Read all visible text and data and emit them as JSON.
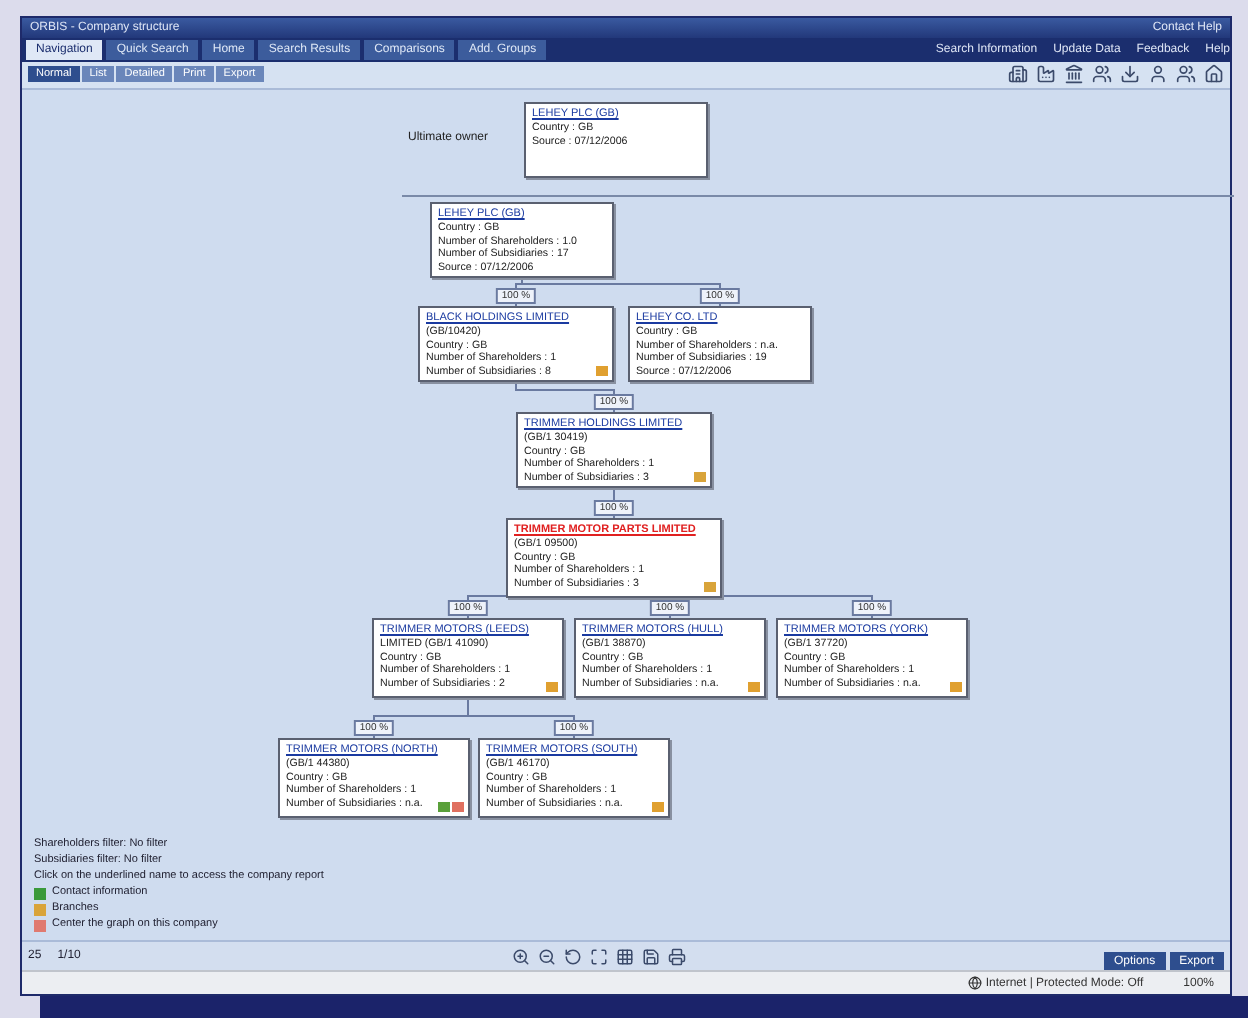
{
  "window": {
    "title": "ORBIS - Company structure",
    "title_right": "Contact Help"
  },
  "tabs": [
    {
      "label": "Navigation",
      "selected": true
    },
    {
      "label": "Quick Search",
      "selected": false
    },
    {
      "label": "Home",
      "selected": false
    },
    {
      "label": "Search Results",
      "selected": false
    },
    {
      "label": "Comparisons",
      "selected": false
    },
    {
      "label": "Add. Groups",
      "selected": false
    }
  ],
  "top_links": [
    "Search Information",
    "Update Data",
    "Feedback",
    "Help"
  ],
  "view_tabs": [
    {
      "label": "Normal",
      "selected": true
    },
    {
      "label": "List",
      "selected": false
    },
    {
      "label": "Detailed",
      "selected": false
    },
    {
      "label": "Print",
      "selected": false
    },
    {
      "label": "Export",
      "selected": false
    }
  ],
  "ultimate_owner_label": "Ultimate owner",
  "graph": {
    "name": "LEHEY PLC (GB)",
    "highlighted": false,
    "lines": [
      "Country : GB",
      "Source : 07/12/2006"
    ],
    "children": [
      {
        "name": "LEHEY PLC (GB)",
        "highlighted": false,
        "lines": [
          "Country : GB",
          "Number of Shareholders : 1.0",
          "Number of Subsidiaries : 17",
          "Source : 07/12/2006"
        ],
        "children": [
          {
            "name": "BLACK HOLDINGS LIMITED",
            "share": "100 %",
            "highlighted": false,
            "lines": [
              "(GB/10420)",
              "Country : GB",
              "Number of Shareholders : 1",
              "Number of Subsidiaries : 8"
            ],
            "flags": [
              {
                "color": "#e0a030"
              }
            ],
            "children": [
              {
                "name": "TRIMMER HOLDINGS LIMITED",
                "share": "100 %",
                "highlighted": false,
                "lines": [
                  "(GB/1 30419)",
                  "Country : GB",
                  "Number of Shareholders : 1",
                  "Number of Subsidiaries : 3"
                ],
                "flags": [
                  {
                    "color": "#d9a43a"
                  }
                ],
                "children": [
                  {
                    "name": "TRIMMER MOTOR PARTS LIMITED",
                    "share": "100 %",
                    "highlighted": true,
                    "lines": [
                      "(GB/1 09500)",
                      "Country : GB",
                      "Number of Shareholders : 1",
                      "Number of Subsidiaries : 3"
                    ],
                    "flags": [
                      {
                        "color": "#d9a43a"
                      }
                    ],
                    "children": [
                      {
                        "name": "TRIMMER MOTORS (LEEDS)",
                        "share": "100 %",
                        "highlighted": false,
                        "lines": [
                          "LIMITED (GB/1 41090)",
                          "Country : GB",
                          "Number of Shareholders : 1",
                          "Number of Subsidiaries : 2"
                        ],
                        "flags": [
                          {
                            "color": "#e0a030"
                          }
                        ],
                        "children": [
                          {
                            "name": "TRIMMER MOTORS (NORTH)",
                            "share": "100 %",
                            "highlighted": false,
                            "lines": [
                              "(GB/1 44380)",
                              "Country : GB",
                              "Number of Shareholders : 1",
                              "Number of Subsidiaries : n.a."
                            ],
                            "flags": [
                              {
                                "color": "#5aa03a"
                              },
                              {
                                "color": "#e07060"
                              }
                            ]
                          },
                          {
                            "name": "TRIMMER MOTORS (SOUTH)",
                            "share": "100 %",
                            "highlighted": false,
                            "lines": [
                              "(GB/1 46170)",
                              "Country : GB",
                              "Number of Shareholders : 1",
                              "Number of Subsidiaries : n.a."
                            ],
                            "flags": [
                              {
                                "color": "#e0a030"
                              }
                            ]
                          }
                        ]
                      },
                      {
                        "name": "TRIMMER MOTORS (HULL)",
                        "share": "100 %",
                        "highlighted": false,
                        "lines": [
                          "(GB/1 38870)",
                          "Country : GB",
                          "Number of Shareholders : 1",
                          "Number of Subsidiaries : n.a."
                        ],
                        "flags": [
                          {
                            "color": "#e0a030"
                          }
                        ]
                      },
                      {
                        "name": "TRIMMER MOTORS (YORK)",
                        "share": "100 %",
                        "highlighted": false,
                        "lines": [
                          "(GB/1 37720)",
                          "Country : GB",
                          "Number of Shareholders : 1",
                          "Number of Subsidiaries : n.a."
                        ],
                        "flags": [
                          {
                            "color": "#e0a030"
                          }
                        ]
                      }
                    ]
                  }
                ]
              }
            ]
          },
          {
            "name": "LEHEY CO. LTD",
            "share": "100 %",
            "highlighted": false,
            "lines": [
              "Country : GB",
              "Number of Shareholders : n.a.",
              "Number of Subsidiaries : 19",
              "Source : 07/12/2006"
            ]
          }
        ]
      }
    ]
  },
  "legend": [
    "Shareholders filter: No filter",
    "Subsidiaries filter: No filter",
    "Click on the underlined name to access the company report"
  ],
  "legend_keys": [
    {
      "label": "Contact information",
      "color": "#3a9a3a"
    },
    {
      "label": "Branches",
      "color": "#d9a43a"
    },
    {
      "label": "Center the graph on this company",
      "color": "#e07a70"
    }
  ],
  "pager": [
    "25",
    "1/10"
  ],
  "buttons": [
    "Options",
    "Export"
  ],
  "status": {
    "zone": "Internet | Protected Mode: Off",
    "zoom": "100%"
  }
}
